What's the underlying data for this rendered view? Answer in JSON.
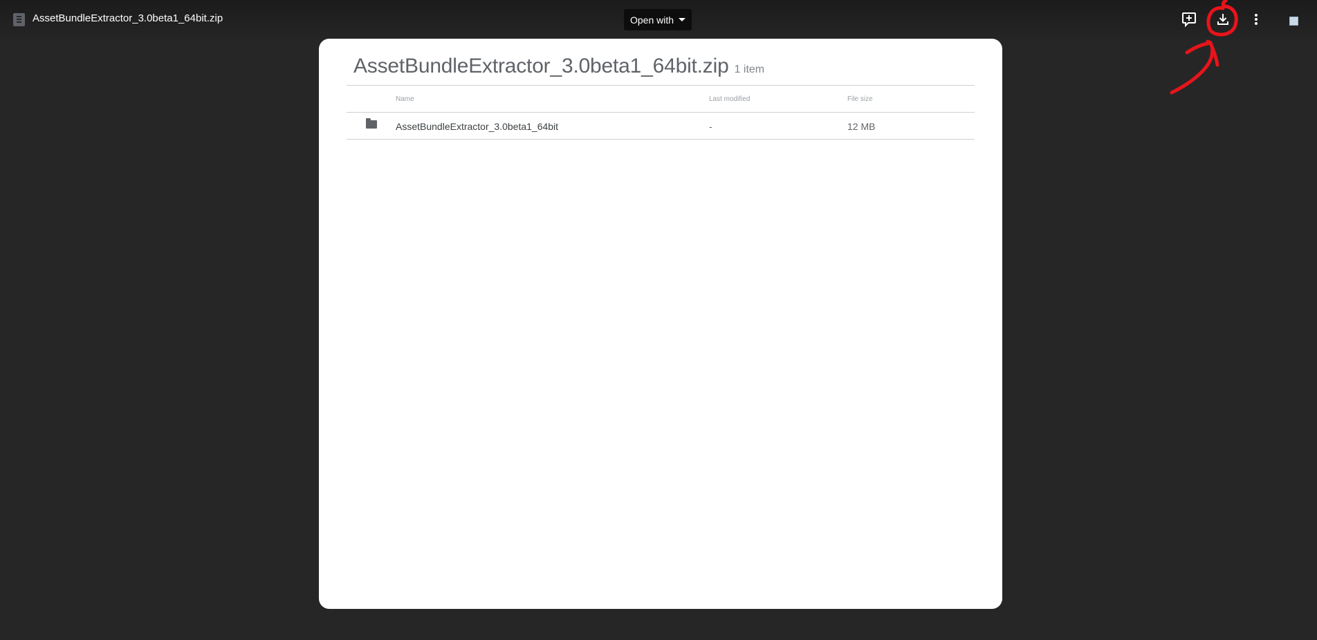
{
  "topbar": {
    "file_icon": "archive-file-icon",
    "file_name": "AssetBundleExtractor_3.0beta1_64bit.zip",
    "open_with_label": "Open with",
    "icons": [
      "add-shortcut-icon",
      "download-icon",
      "more-vert-icon",
      "avatar-icon"
    ]
  },
  "annotation": {
    "color": "#e8141b",
    "shapes": [
      "circle-around-download-icon",
      "arrow-to-download-icon"
    ]
  },
  "archive": {
    "title": "AssetBundleExtractor_3.0beta1_64bit.zip",
    "item_count": "1 item",
    "columns": {
      "name": "Name",
      "last_modified": "Last modified",
      "file_size": "File size"
    },
    "rows": [
      {
        "icon": "folder-icon",
        "name": "AssetBundleExtractor_3.0beta1_64bit",
        "last_modified": "-",
        "file_size": "12 MB"
      }
    ]
  }
}
